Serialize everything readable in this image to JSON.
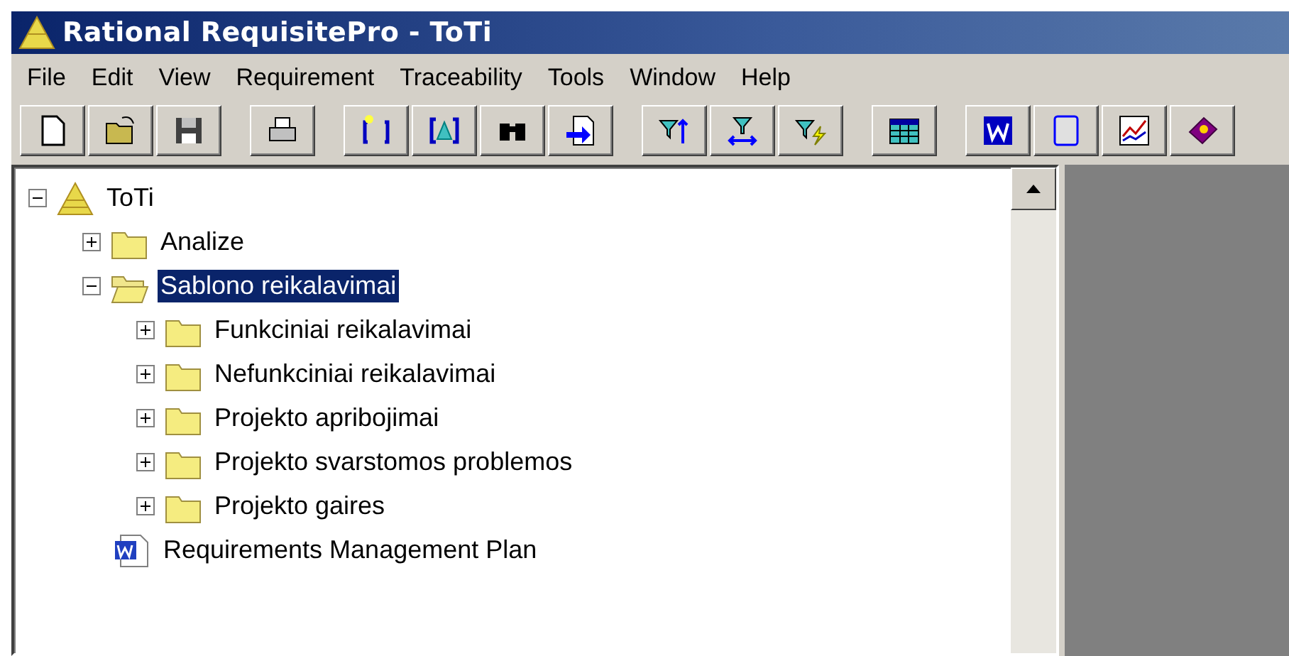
{
  "window": {
    "title": "Rational RequisitePro - ToTi"
  },
  "menu": [
    {
      "label": "File"
    },
    {
      "label": "Edit"
    },
    {
      "label": "View"
    },
    {
      "label": "Requirement"
    },
    {
      "label": "Traceability"
    },
    {
      "label": "Tools"
    },
    {
      "label": "Window"
    },
    {
      "label": "Help"
    }
  ],
  "tree": [
    {
      "label": "ToTi",
      "kind": "project",
      "expanded": true,
      "selected": false,
      "children": [
        {
          "label": "Analize",
          "kind": "folder",
          "expanded": false,
          "selected": false
        },
        {
          "label": "Sablono reikalavimai",
          "kind": "folder",
          "expanded": true,
          "selected": true,
          "children": [
            {
              "label": "Funkciniai reikalavimai",
              "kind": "folder",
              "expanded": false,
              "selected": false
            },
            {
              "label": "Nefunkciniai reikalavimai",
              "kind": "folder",
              "expanded": false,
              "selected": false
            },
            {
              "label": "Projekto apribojimai",
              "kind": "folder",
              "expanded": false,
              "selected": false
            },
            {
              "label": "Projekto svarstomos problemos",
              "kind": "folder",
              "expanded": false,
              "selected": false
            },
            {
              "label": "Projekto gaires",
              "kind": "folder",
              "expanded": false,
              "selected": false
            }
          ]
        },
        {
          "label": "Requirements Management Plan",
          "kind": "document",
          "selected": false
        }
      ]
    }
  ]
}
